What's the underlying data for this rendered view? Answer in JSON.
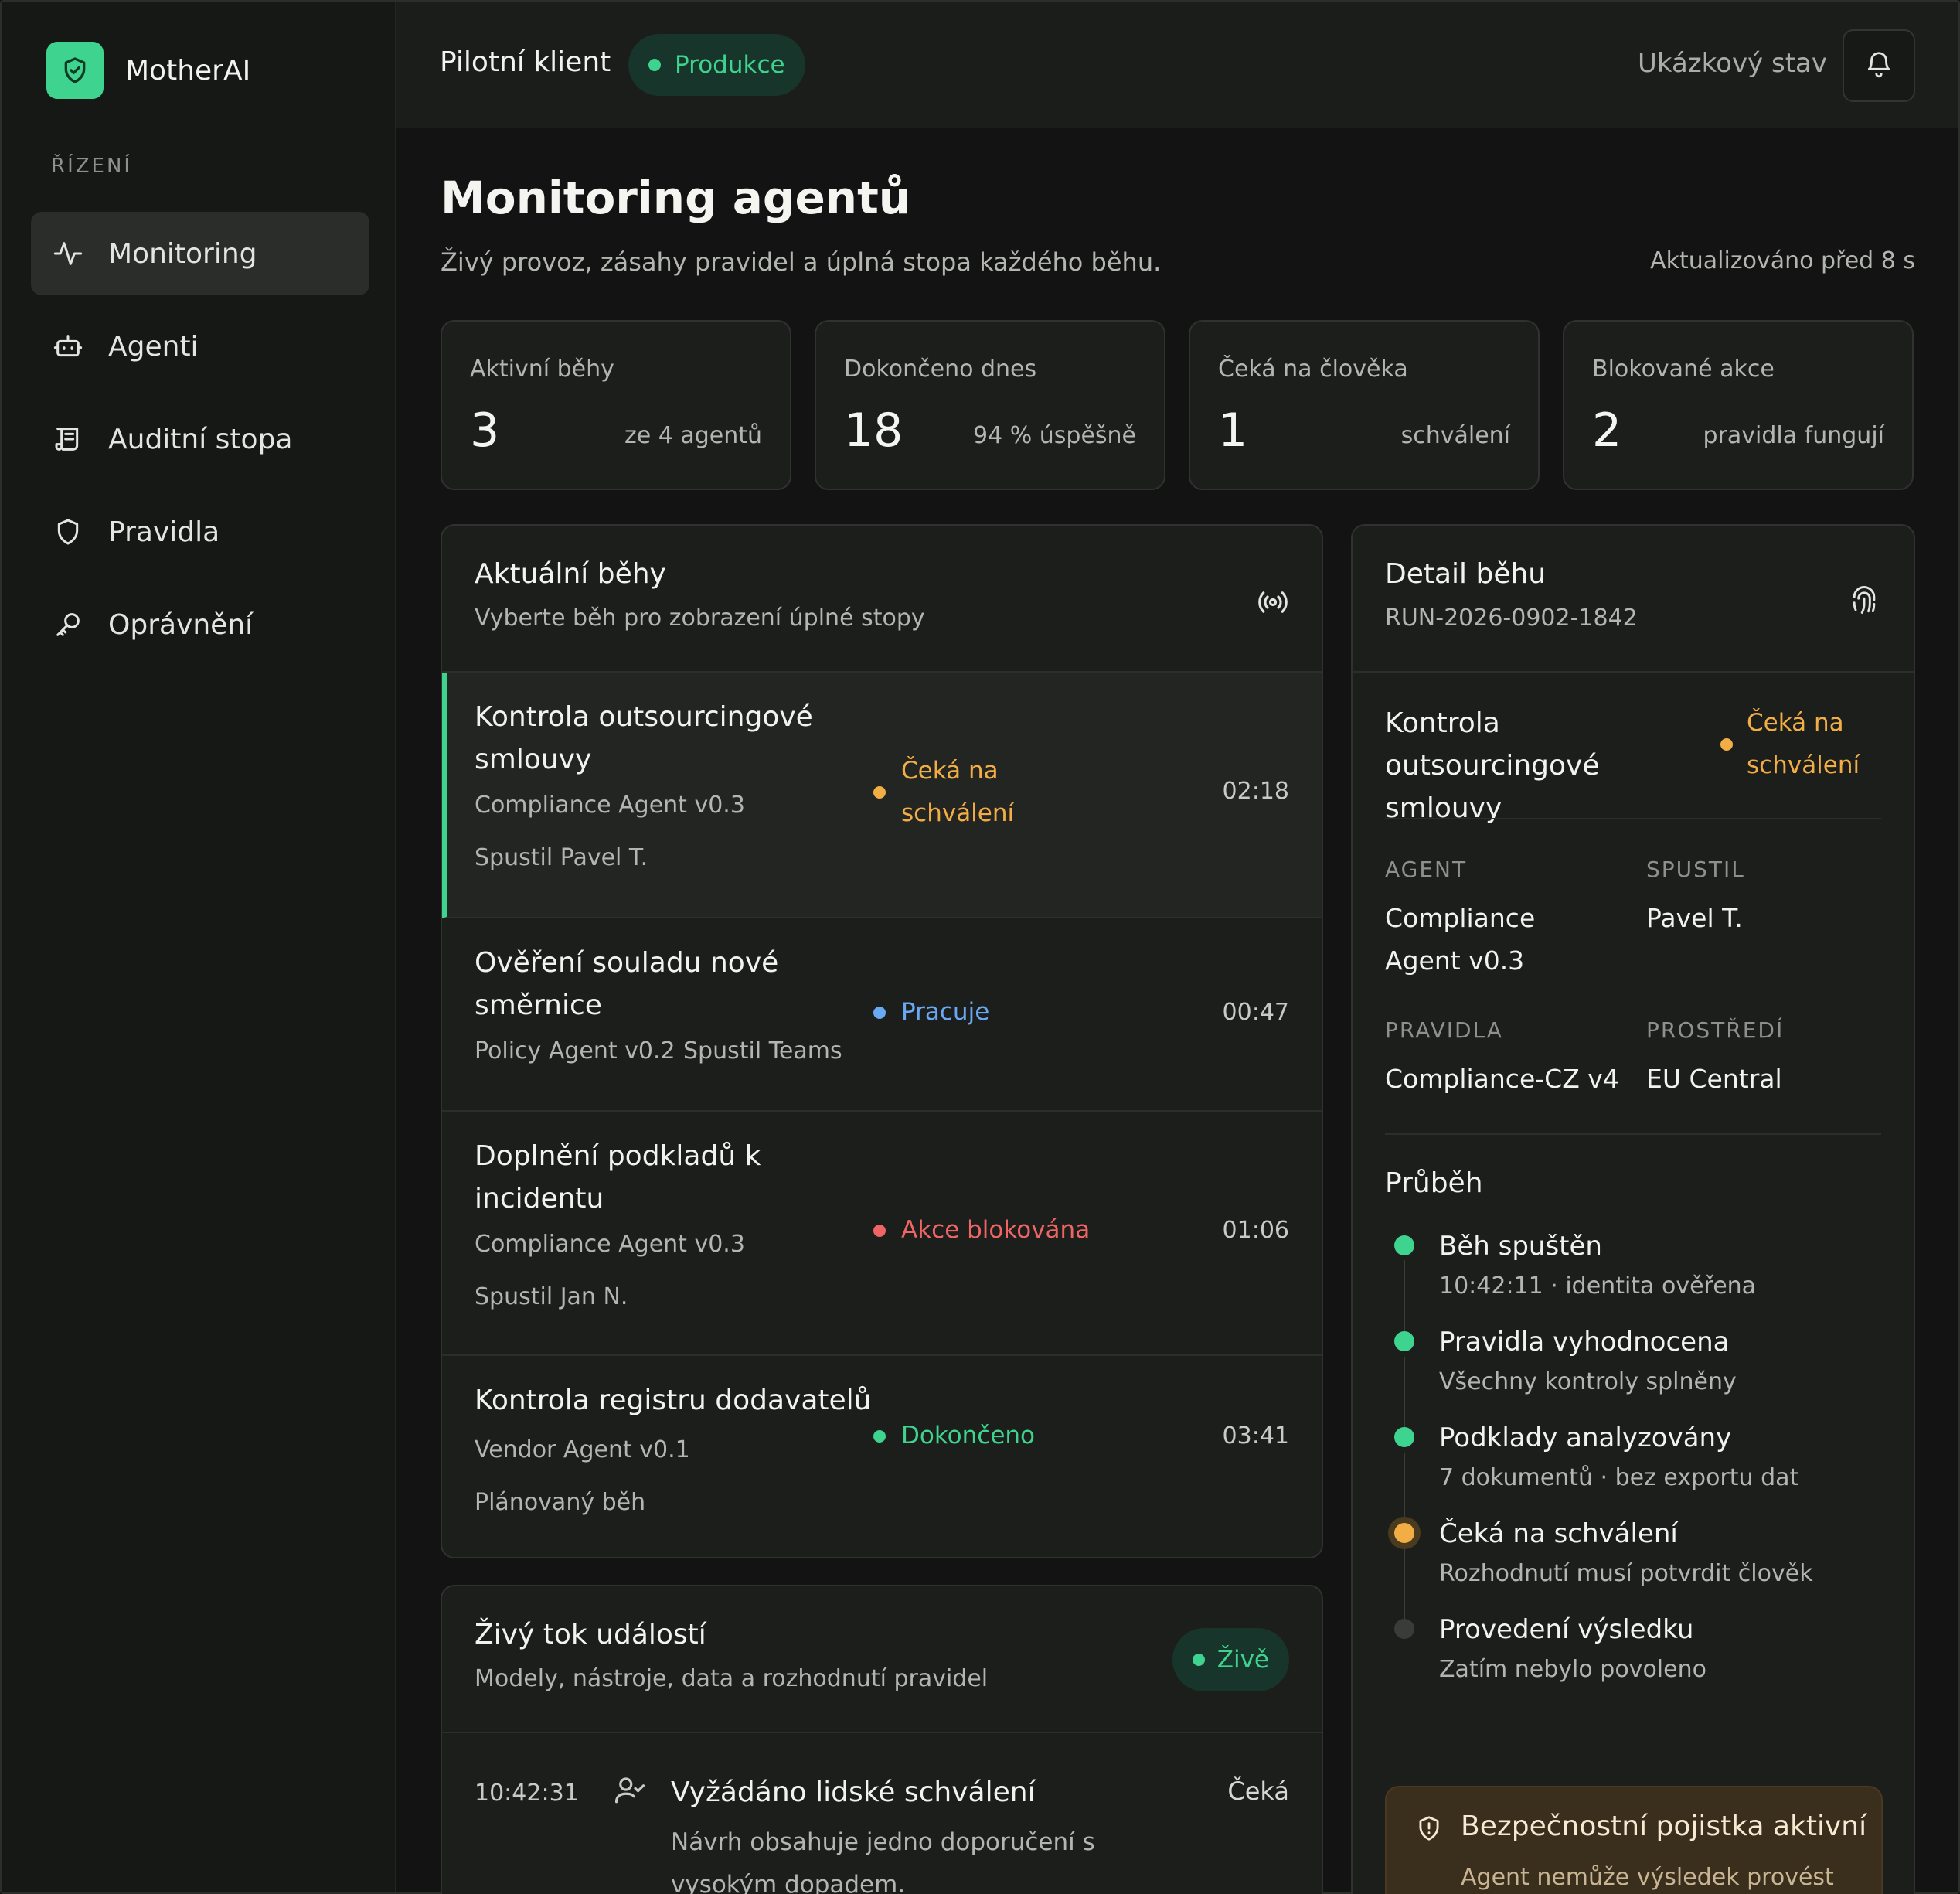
{
  "brand": {
    "name": "MotherAI",
    "logo_icon": "shield-check-icon",
    "accent": "#3ed38e"
  },
  "sidebar": {
    "section": "ŘÍZENÍ",
    "items": [
      {
        "label": "Monitoring",
        "icon": "activity-icon",
        "active": true
      },
      {
        "label": "Agenti",
        "icon": "robot-icon"
      },
      {
        "label": "Auditní stopa",
        "icon": "scroll-icon"
      },
      {
        "label": "Pravidla",
        "icon": "shield-icon"
      },
      {
        "label": "Oprávnění",
        "icon": "key-icon"
      }
    ]
  },
  "topbar": {
    "client": "Pilotní klient",
    "env": "Produkce",
    "demo": "Ukázkový stav",
    "bell_icon": "bell-icon"
  },
  "page": {
    "title": "Monitoring agentů",
    "subtitle": "Živý provoz, zásahy pravidel a úplná stopa každého běhu.",
    "updated": "Aktualizováno před 8 s"
  },
  "stats": [
    {
      "label": "Aktivní běhy",
      "value": "3",
      "note": "ze 4 agentů",
      "color": "#f4f4f1"
    },
    {
      "label": "Dokončeno dnes",
      "value": "18",
      "note": "94 % úspěšně",
      "color": "#f4f4f1"
    },
    {
      "label": "Čeká na člověka",
      "value": "1",
      "note": "schválení",
      "color": "#f2ad45"
    },
    {
      "label": "Blokované akce",
      "value": "2",
      "note": "pravidla fungují",
      "color": "#ef6464"
    }
  ],
  "runs": {
    "title": "Aktuální běhy",
    "subtitle": "Vyberte běh pro zobrazení úplné stopy",
    "icon": "broadcast-icon",
    "items": [
      {
        "title": "Kontrola outsourcingové smlouvy",
        "agent": "Compliance Agent v0.3",
        "by": "Spustil Pavel T.",
        "status": "Čeká na schválení",
        "status_color": "#f2ad45",
        "time": "02:18"
      },
      {
        "title": "Ověření souladu nové směrnice",
        "agent": "Policy Agent v0.2",
        "by": "Spustil Teams",
        "status": "Pracuje",
        "status_color": "#69a8f2",
        "time": "00:47"
      },
      {
        "title": "Doplnění podkladů k incidentu",
        "agent": "Compliance Agent v0.3",
        "by": "Spustil Jan N.",
        "status": "Akce blokována",
        "status_color": "#ef6464",
        "time": "01:06"
      },
      {
        "title": "Kontrola registru dodavatelů",
        "agent": "Vendor Agent v0.1",
        "by": "Plánovaný běh",
        "status": "Dokončeno",
        "status_color": "#3ed38e",
        "time": "03:41"
      }
    ]
  },
  "events": {
    "title": "Živý tok událostí",
    "subtitle": "Modely, nástroje, data a rozhodnutí pravidel",
    "live": "Živě",
    "items": [
      {
        "time": "10:42:31",
        "icon": "user-check-icon",
        "title": "Vyžádáno lidské schválení",
        "desc": "Návrh obsahuje jedno doporučení s vysokým dopadem.",
        "status": "Čeká"
      }
    ]
  },
  "detail": {
    "title": "Detail běhu",
    "run_id": "RUN-2026-0902-1842",
    "icon": "fingerprint-icon",
    "run_title": "Kontrola outsourcingové smlouvy",
    "status": "Čeká na schválení",
    "fields": {
      "agent_label": "AGENT",
      "agent": "Compliance Agent v0.3",
      "by_label": "SPUSTIL",
      "by": "Pavel T.",
      "rules_label": "PRAVIDLA",
      "rules": "Compliance-CZ v4",
      "env_label": "PROSTŘEDÍ",
      "env": "EU Central"
    },
    "progress_title": "Průběh",
    "steps": [
      {
        "title": "Běh spuštěn",
        "sub": "10:42:11 · identita ověřena",
        "state": "done"
      },
      {
        "title": "Pravidla vyhodnocena",
        "sub": "Všechny kontroly splněny",
        "state": "done"
      },
      {
        "title": "Podklady analyzovány",
        "sub": "7 dokumentů · bez exportu dat",
        "state": "done"
      },
      {
        "title": "Čeká na schválení",
        "sub": "Rozhodnutí musí potvrdit člověk",
        "state": "pending"
      },
      {
        "title": "Provedení výsledku",
        "sub": "Zatím nebylo povoleno",
        "state": "todo"
      }
    ],
    "guard": {
      "title": "Bezpečnostní pojistka aktivní",
      "sub": "Agent nemůže výsledek provést bez lidského schválení.",
      "icon": "shield-alert-icon"
    }
  }
}
